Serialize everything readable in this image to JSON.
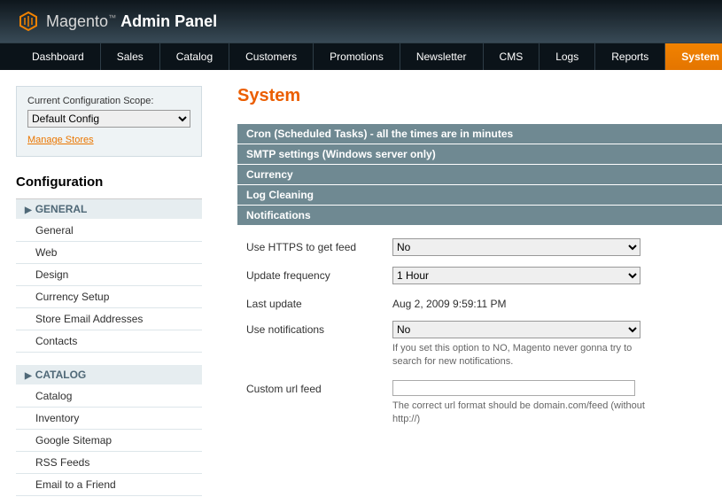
{
  "header": {
    "brand": "Magento",
    "panel": "Admin Panel"
  },
  "nav": {
    "items": [
      {
        "label": "Dashboard",
        "active": false
      },
      {
        "label": "Sales",
        "active": false
      },
      {
        "label": "Catalog",
        "active": false
      },
      {
        "label": "Customers",
        "active": false
      },
      {
        "label": "Promotions",
        "active": false
      },
      {
        "label": "Newsletter",
        "active": false
      },
      {
        "label": "CMS",
        "active": false
      },
      {
        "label": "Logs",
        "active": false
      },
      {
        "label": "Reports",
        "active": false
      },
      {
        "label": "System",
        "active": true
      }
    ]
  },
  "scope": {
    "label": "Current Configuration Scope:",
    "value": "Default Config",
    "manage": "Manage Stores"
  },
  "sidebar": {
    "title": "Configuration",
    "sections": [
      {
        "title": "GENERAL",
        "items": [
          "General",
          "Web",
          "Design",
          "Currency Setup",
          "Store Email Addresses",
          "Contacts"
        ]
      },
      {
        "title": "CATALOG",
        "items": [
          "Catalog",
          "Inventory",
          "Google Sitemap",
          "RSS Feeds",
          "Email to a Friend"
        ]
      }
    ]
  },
  "page": {
    "title": "System"
  },
  "panels": [
    {
      "title": "Cron (Scheduled Tasks) - all the times are in minutes"
    },
    {
      "title": "SMTP settings (Windows server only)"
    },
    {
      "title": "Currency"
    },
    {
      "title": "Log Cleaning"
    },
    {
      "title": "Notifications"
    }
  ],
  "form": {
    "https": {
      "label": "Use HTTPS to get feed",
      "value": "No"
    },
    "freq": {
      "label": "Update frequency",
      "value": "1 Hour"
    },
    "last": {
      "label": "Last update",
      "value": "Aug 2, 2009 9:59:11 PM"
    },
    "use": {
      "label": "Use notifications",
      "value": "No",
      "note": "If you set this option to NO, Magento never gonna try to search for new notifications."
    },
    "custom": {
      "label": "Custom url feed",
      "value": "",
      "note": "The correct url format should be domain.com/feed (without http://)"
    }
  }
}
